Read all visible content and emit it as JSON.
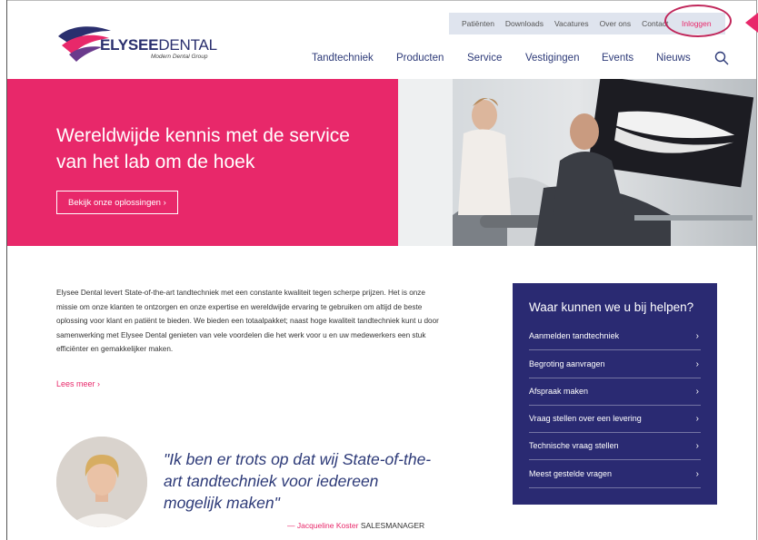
{
  "utility_nav": {
    "items": [
      "Patiënten",
      "Downloads",
      "Vacatures",
      "Over ons",
      "Contact"
    ],
    "login": "Inloggen"
  },
  "logo": {
    "name_bold": "ELYSEE",
    "name_light": "DENTAL",
    "tagline": "Modern Dental Group"
  },
  "main_nav": {
    "items": [
      "Tandtechniek",
      "Producten",
      "Service",
      "Vestigingen",
      "Events",
      "Nieuws"
    ]
  },
  "hero": {
    "title": "Wereldwijde kennis met de service van het lab om de hoek",
    "button_label": "Bekijk onze oplossingen  ›"
  },
  "intro": {
    "text": "Elysee Dental levert State-of-the-art tandtechniek met een constante kwaliteit tegen scherpe prijzen. Het is onze missie om onze klanten te ontzorgen en onze expertise en wereldwijde ervaring te gebruiken om altijd de beste oplossing voor klant en patiënt te bieden. We bieden een totaalpakket; naast hoge kwaliteit tandtechniek kunt u door samenwerking met Elysee Dental genieten van vele voordelen die het werk voor u en uw medewerkers een stuk efficiënter en gemakkelijker maken.",
    "read_more": "Lees meer  ›"
  },
  "help": {
    "title": "Waar kunnen we u bij helpen?",
    "items": [
      "Aanmelden tandtechniek",
      "Begroting aanvragen",
      "Afspraak maken",
      "Vraag stellen over een levering",
      "Technische vraag stellen",
      "Meest gestelde vragen"
    ],
    "chevron": "›"
  },
  "quote": {
    "text": "\"Ik ben er trots op dat wij State-of-the-art tandtechniek voor iedereen mogelijk maken\"",
    "author": "— Jacqueline Koster",
    "role": "SALESMANAGER"
  },
  "colors": {
    "brand_pink": "#e8286a",
    "brand_navy": "#2a2a72",
    "utility_bg": "#dfe4ee"
  }
}
